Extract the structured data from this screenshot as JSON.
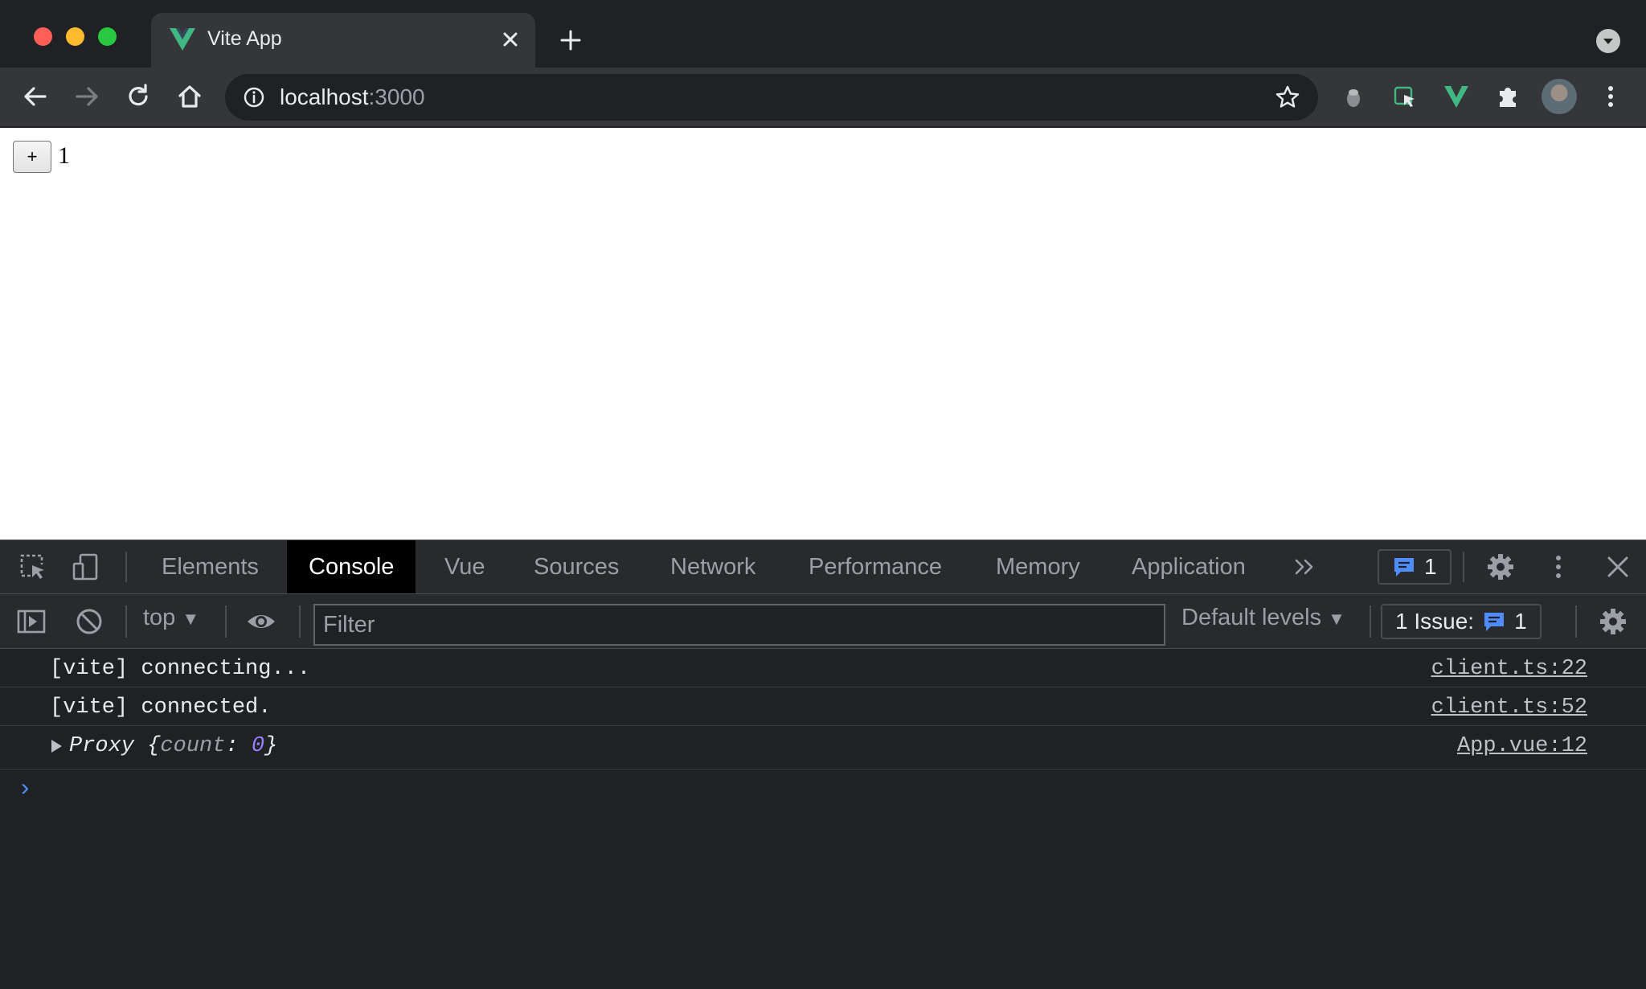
{
  "browser": {
    "tab": {
      "title": "Vite App"
    },
    "omnibox": {
      "host": "localhost",
      "port": ":3000"
    }
  },
  "page": {
    "button_label": "+",
    "count": "1"
  },
  "devtools": {
    "tabs": [
      {
        "label": "Elements"
      },
      {
        "label": "Console"
      },
      {
        "label": "Vue"
      },
      {
        "label": "Sources"
      },
      {
        "label": "Network"
      },
      {
        "label": "Performance"
      },
      {
        "label": "Memory"
      },
      {
        "label": "Application"
      }
    ],
    "issues_badge": "1",
    "toolbar": {
      "context": "top",
      "filter_placeholder": "Filter",
      "levels": "Default levels",
      "issues_label": "1 Issue:",
      "issues_count": "1"
    },
    "messages": [
      {
        "text": "[vite] connecting...",
        "source": "client.ts:22"
      },
      {
        "text": "[vite] connected.",
        "source": "client.ts:52"
      }
    ],
    "object_message": {
      "name": "Proxy",
      "open": "{",
      "key": "count",
      "colon": ":",
      "value": "0",
      "close": "}",
      "source": "App.vue:12"
    },
    "prompt": "›"
  },
  "colors": {
    "vue_green": "#41b883",
    "active_tab": "#000000",
    "accent_blue": "#4e8cff"
  }
}
